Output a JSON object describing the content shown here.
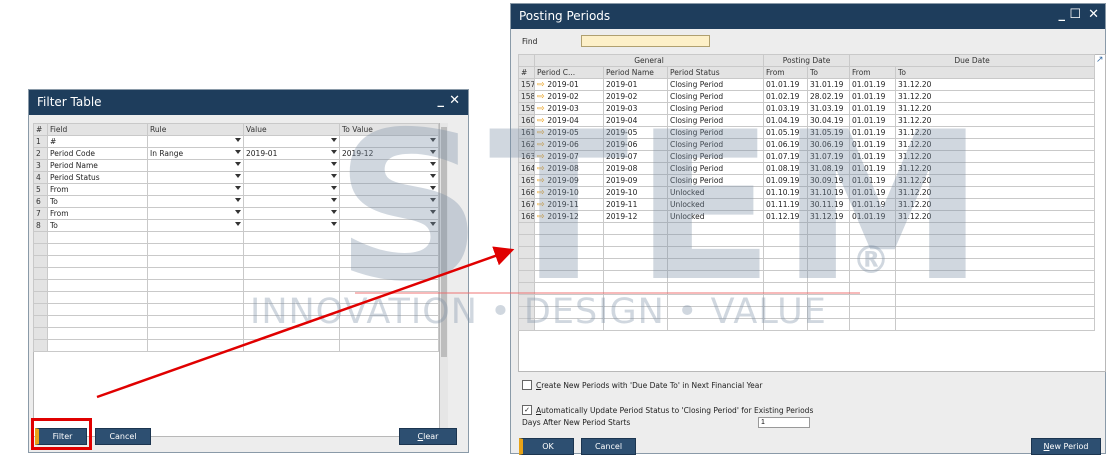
{
  "filter_window": {
    "title": "Filter Table",
    "minimize_icon": "minimize-icon",
    "close_icon": "close-icon",
    "headers": [
      "#",
      "Field",
      "Rule",
      "Value",
      "To Value"
    ],
    "rows": [
      {
        "num": "1",
        "field": "#",
        "rule": "",
        "value": "",
        "to": ""
      },
      {
        "num": "2",
        "field": "Period Code",
        "rule": "In Range",
        "value": "2019-01",
        "to": "2019-12"
      },
      {
        "num": "3",
        "field": "Period Name",
        "rule": "",
        "value": "",
        "to": ""
      },
      {
        "num": "4",
        "field": "Period Status",
        "rule": "",
        "value": "",
        "to": ""
      },
      {
        "num": "5",
        "field": "From",
        "rule": "",
        "value": "",
        "to": ""
      },
      {
        "num": "6",
        "field": "To",
        "rule": "",
        "value": "",
        "to": ""
      },
      {
        "num": "7",
        "field": "From",
        "rule": "",
        "value": "",
        "to": ""
      },
      {
        "num": "8",
        "field": "To",
        "rule": "",
        "value": "",
        "to": ""
      }
    ],
    "buttons": {
      "filter": "Filter",
      "cancel": "Cancel",
      "clear": "Clear"
    }
  },
  "posting_window": {
    "title": "Posting Periods",
    "find_label": "Find",
    "find_value": "",
    "groups": {
      "general": "General",
      "posting_date": "Posting Date",
      "due_date": "Due Date"
    },
    "headers": [
      "#",
      "Period C...",
      "Period Name",
      "Period Status",
      "From",
      "To",
      "From",
      "To"
    ],
    "rows": [
      {
        "num": "157",
        "code": "2019-01",
        "name": "2019-01",
        "status": "Closing Period",
        "pfrom": "01.01.19",
        "pto": "31.01.19",
        "dfrom": "01.01.19",
        "dto": "31.12.20"
      },
      {
        "num": "158",
        "code": "2019-02",
        "name": "2019-02",
        "status": "Closing Period",
        "pfrom": "01.02.19",
        "pto": "28.02.19",
        "dfrom": "01.01.19",
        "dto": "31.12.20"
      },
      {
        "num": "159",
        "code": "2019-03",
        "name": "2019-03",
        "status": "Closing Period",
        "pfrom": "01.03.19",
        "pto": "31.03.19",
        "dfrom": "01.01.19",
        "dto": "31.12.20"
      },
      {
        "num": "160",
        "code": "2019-04",
        "name": "2019-04",
        "status": "Closing Period",
        "pfrom": "01.04.19",
        "pto": "30.04.19",
        "dfrom": "01.01.19",
        "dto": "31.12.20"
      },
      {
        "num": "161",
        "code": "2019-05",
        "name": "2019-05",
        "status": "Closing Period",
        "pfrom": "01.05.19",
        "pto": "31.05.19",
        "dfrom": "01.01.19",
        "dto": "31.12.20"
      },
      {
        "num": "162",
        "code": "2019-06",
        "name": "2019-06",
        "status": "Closing Period",
        "pfrom": "01.06.19",
        "pto": "30.06.19",
        "dfrom": "01.01.19",
        "dto": "31.12.20"
      },
      {
        "num": "163",
        "code": "2019-07",
        "name": "2019-07",
        "status": "Closing Period",
        "pfrom": "01.07.19",
        "pto": "31.07.19",
        "dfrom": "01.01.19",
        "dto": "31.12.20"
      },
      {
        "num": "164",
        "code": "2019-08",
        "name": "2019-08",
        "status": "Closing Period",
        "pfrom": "01.08.19",
        "pto": "31.08.19",
        "dfrom": "01.01.19",
        "dto": "31.12.20"
      },
      {
        "num": "165",
        "code": "2019-09",
        "name": "2019-09",
        "status": "Closing Period",
        "pfrom": "01.09.19",
        "pto": "30.09.19",
        "dfrom": "01.01.19",
        "dto": "31.12.20"
      },
      {
        "num": "166",
        "code": "2019-10",
        "name": "2019-10",
        "status": "Unlocked",
        "pfrom": "01.10.19",
        "pto": "31.10.19",
        "dfrom": "01.01.19",
        "dto": "31.12.20"
      },
      {
        "num": "167",
        "code": "2019-11",
        "name": "2019-11",
        "status": "Unlocked",
        "pfrom": "01.11.19",
        "pto": "30.11.19",
        "dfrom": "01.01.19",
        "dto": "31.12.20"
      },
      {
        "num": "168",
        "code": "2019-12",
        "name": "2019-12",
        "status": "Unlocked",
        "pfrom": "01.12.19",
        "pto": "31.12.19",
        "dfrom": "01.01.19",
        "dto": "31.12.20"
      }
    ],
    "check_create_first": "C",
    "check_create_rest": "reate New Periods with 'Due Date To' in Next Financial Year",
    "check_update_first": "A",
    "check_update_rest": "utomatically Update Period Status to 'Closing Period' for Existing Periods",
    "days_label": "Days After New Period Starts",
    "days_value": "1",
    "buttons": {
      "ok": "OK",
      "cancel": "Cancel",
      "new_period_first": "N",
      "new_period_rest": "ew Period"
    }
  },
  "watermark": {
    "brand": "STEM",
    "registered": "®",
    "tagline": "INNOVATION • DESIGN • VALUE"
  },
  "colors": {
    "titlebar": "#1e3d5c",
    "button": "#2d4f71",
    "highlight": "#e00000",
    "accent": "#e8a317"
  }
}
